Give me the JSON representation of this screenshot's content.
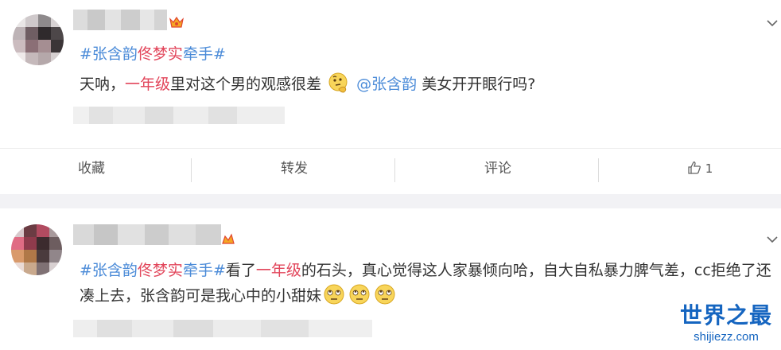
{
  "posts": [
    {
      "topic_prefix": "#张含韵",
      "topic_highlight": "佟梦实",
      "topic_suffix": "牵手#",
      "text_before_kw": "天呐，",
      "keyword": "一年级",
      "text_after_kw": "里对这个男的观感很差",
      "mention": "@张含韵",
      "text_after_mention": " 美女开开眼行吗?",
      "actions": {
        "favorite": "收藏",
        "repost": "转发",
        "comment": "评论",
        "like_count": "1"
      }
    },
    {
      "topic_prefix": "#张含韵",
      "topic_highlight": "佟梦实",
      "topic_suffix": "牵手#",
      "text_before_kw": "看了",
      "keyword": "一年级",
      "text_after_kw": "的石头，真心觉得这人家暴倾向哈，自大自私暴力脾气差，cc拒绝了还凑上去，张含韵可是我心中的小甜妹"
    }
  ],
  "watermark": {
    "title": "世界之最",
    "site": "shijiezz.com"
  },
  "colors": {
    "topic": "#4b8bd8",
    "keyword": "#e2465b",
    "separator": "#f2f2f5"
  },
  "icons": [
    "crown-icon",
    "chevron-down-icon",
    "thinking-face-icon",
    "rolling-eyes-icon",
    "thumbs-up-icon"
  ]
}
